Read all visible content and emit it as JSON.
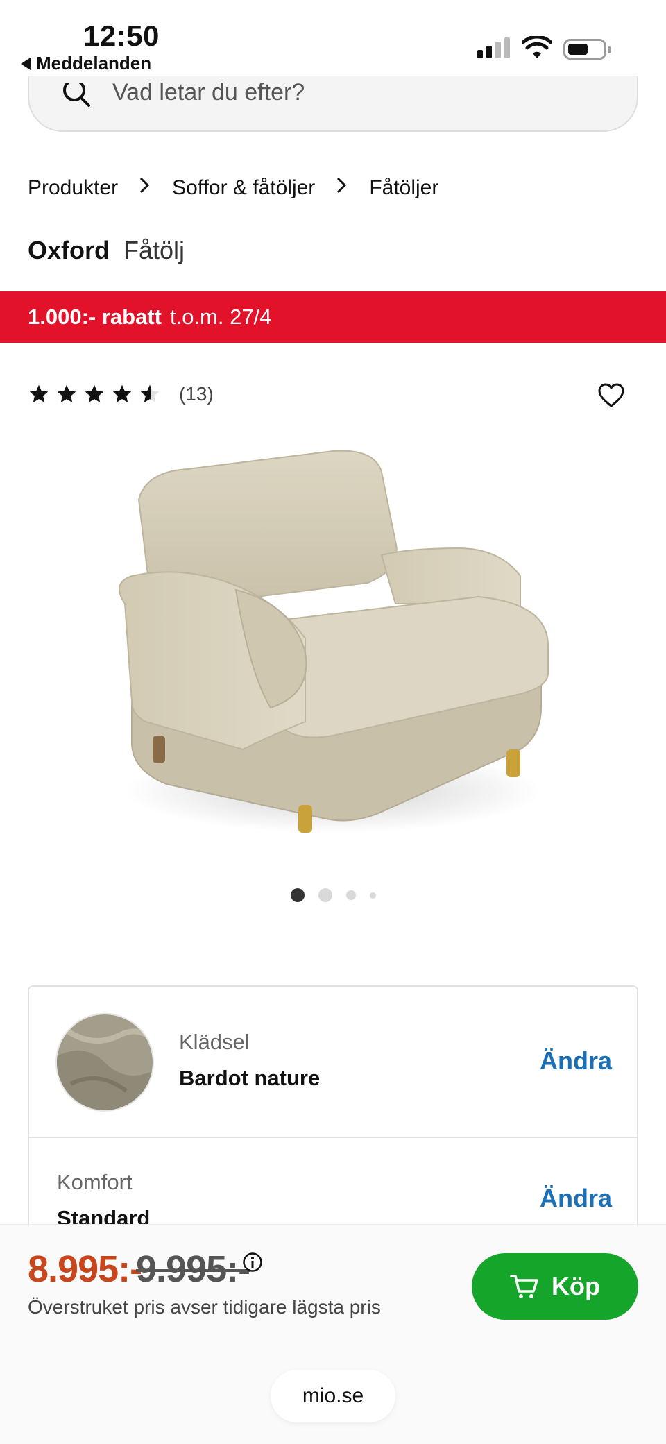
{
  "status_bar": {
    "time": "12:50",
    "back_app": "Meddelanden"
  },
  "search": {
    "placeholder": "Vad letar du efter?"
  },
  "breadcrumb": [
    "Produkter",
    "Soffor & fåtöljer",
    "Fåtöljer"
  ],
  "product": {
    "brand": "Oxford",
    "type": "Fåtölj"
  },
  "promo": {
    "bold": "1.000:- rabatt",
    "rest": "t.o.m. 27/4"
  },
  "rating": {
    "stars": 4.5,
    "count": "(13)"
  },
  "gallery": {
    "slides": 4,
    "active": 1
  },
  "options": [
    {
      "label": "Klädsel",
      "value": "Bardot nature",
      "action": "Ändra"
    },
    {
      "label": "Komfort",
      "value": "Standard",
      "action": "Ändra"
    }
  ],
  "buy": {
    "price": "8.995:-",
    "old_price": "9.995:-",
    "note": "Överstruket pris avser tidigare lägsta pris",
    "button": "Köp"
  },
  "browser": {
    "url": "mio.se"
  },
  "colors": {
    "promo": "#e3122b",
    "price": "#c8461b",
    "buy": "#15a52b",
    "link": "#1b6fb5"
  }
}
